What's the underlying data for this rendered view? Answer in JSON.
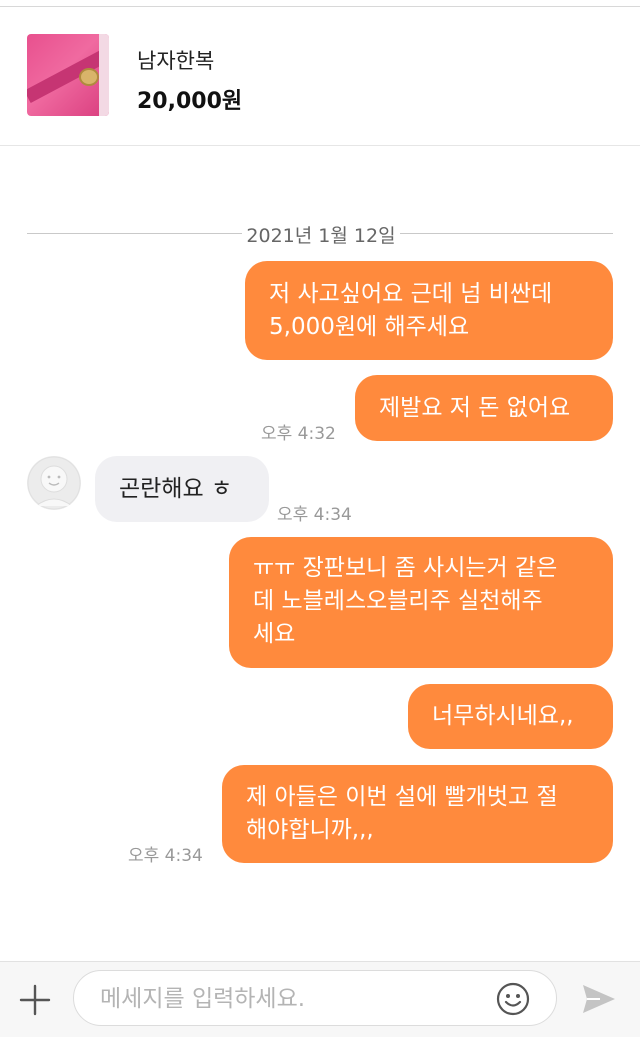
{
  "product": {
    "name": "남자한복",
    "price": "20,000원"
  },
  "chat": {
    "date": "2021년 1월 12일",
    "messages": [
      {
        "from": "me",
        "lines": [
          "저 사고싶어요 근데 넘 비싼데",
          "5,000원에 해주세요"
        ]
      },
      {
        "from": "me",
        "lines": [
          "제발요 저 돈 없어요"
        ],
        "time": "오후 4:32"
      },
      {
        "from": "them",
        "lines": [
          "곤란해요 ㅎ"
        ],
        "time": "오후 4:34"
      },
      {
        "from": "me",
        "lines": [
          "ㅠㅠ 장판보니 좀 사시는거 같은",
          "데 노블레스오블리주 실천해주",
          "세요"
        ]
      },
      {
        "from": "me",
        "lines": [
          "너무하시네요,,"
        ]
      },
      {
        "from": "me",
        "lines": [
          "제 아들은 이번 설에 빨개벗고 절",
          "해야합니까,,,"
        ],
        "time": "오후 4:34"
      }
    ]
  },
  "composer": {
    "placeholder": "메세지를 입력하세요."
  },
  "icons": {
    "attach": "plus-icon",
    "emoji": "smiley-icon",
    "send": "send-icon",
    "avatar": "default-profile-avatar"
  },
  "colors": {
    "outgoing_bubble": "#ff8a3d",
    "incoming_bubble": "#f0f0f3",
    "timestamp": "#999999"
  }
}
